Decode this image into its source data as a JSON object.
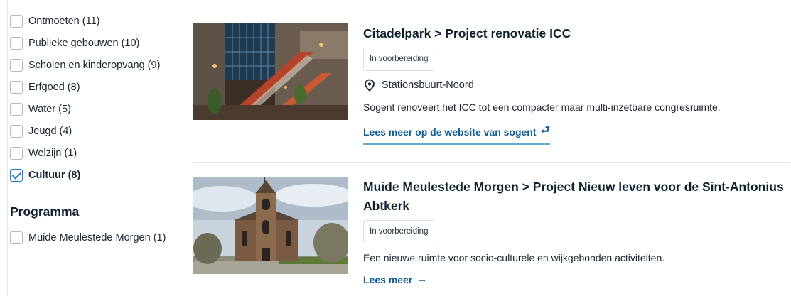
{
  "facets": [
    {
      "label": "Ontmoeten (11)",
      "checked": false
    },
    {
      "label": "Publieke gebouwen (10)",
      "checked": false
    },
    {
      "label": "Scholen en kinderopvang (9)",
      "checked": false
    },
    {
      "label": "Erfgoed (8)",
      "checked": false
    },
    {
      "label": "Water (5)",
      "checked": false
    },
    {
      "label": "Jeugd (4)",
      "checked": false
    },
    {
      "label": "Welzijn (1)",
      "checked": false
    },
    {
      "label": "Cultuur (8)",
      "checked": true
    }
  ],
  "programma": {
    "heading": "Programma",
    "items": [
      {
        "label": "Muide Meulestede Morgen (1)",
        "checked": false
      }
    ]
  },
  "results": [
    {
      "title": "Citadelpark > Project renovatie ICC",
      "status": "In voorbereiding",
      "location": "Stationsbuurt-Noord",
      "description": "Sogent renoveert het ICC tot een compacter maar multi-inzetbare congresruimte.",
      "link_label": "Lees meer op de website van sogent",
      "link_icon": "external-arrow-icon"
    },
    {
      "title": "Muide Meulestede Morgen > Project Nieuw leven voor de Sint-Antonius Abtkerk",
      "status": "In voorbereiding",
      "description": "Een nieuwe ruimte voor socio-culturele en wijkgebonden activiteiten.",
      "link_label": "Lees meer",
      "link_icon": "arrow-right-icon"
    }
  ],
  "colors": {
    "accent": "#1f7ecf",
    "link": "#0d5c96",
    "text": "#1b2530"
  }
}
